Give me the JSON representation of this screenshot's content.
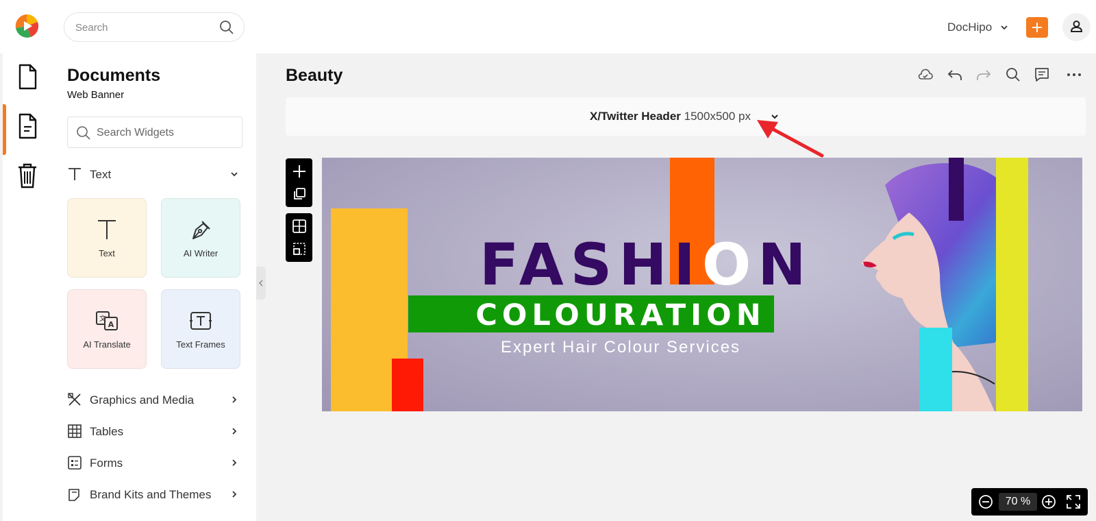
{
  "header": {
    "search_placeholder": "Search",
    "account_name": "DocHipo",
    "brand_color": "#f47b20"
  },
  "rail": {
    "items": [
      {
        "icon": "document-icon"
      },
      {
        "icon": "active-document-icon",
        "active": true
      },
      {
        "icon": "trash-icon"
      }
    ]
  },
  "panel": {
    "title": "Documents",
    "subtitle": "Web Banner",
    "search_placeholder": "Search Widgets",
    "text_section": "Text",
    "cards": [
      {
        "label": "Text",
        "color": "#fdf4e1"
      },
      {
        "label": "AI Writer",
        "color": "#e6f7f5"
      },
      {
        "label": "AI Translate",
        "color": "#fdecea"
      },
      {
        "label": "Text Frames",
        "color": "#eaf1fa"
      }
    ],
    "sections": [
      {
        "label": "Graphics and Media"
      },
      {
        "label": "Tables"
      },
      {
        "label": "Forms"
      },
      {
        "label": "Brand Kits and Themes"
      }
    ]
  },
  "document": {
    "title": "Beauty",
    "size_name": "X/Twitter Header",
    "size_dims": "1500x500 px"
  },
  "banner": {
    "headline_pre": "FASHI",
    "headline_o": "O",
    "headline_post": "N",
    "subheadline": "COLOURATION",
    "tagline": "Expert Hair Colour Services",
    "colors": {
      "purple": "#350a62",
      "orange": "#ff6304",
      "yellow": "#fbbd2e",
      "red": "#ff1a05",
      "green": "#119a08",
      "cyan": "#2fe0ea",
      "lime": "#e5e628"
    }
  },
  "zoom": {
    "value": "70",
    "unit": "%"
  }
}
